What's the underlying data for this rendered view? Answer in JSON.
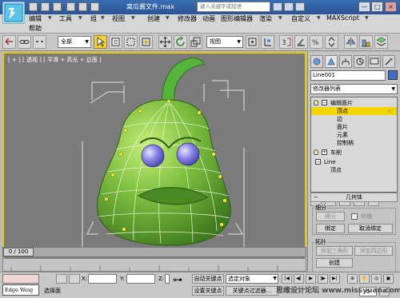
{
  "window": {
    "title": "窝瓜酱文件.max",
    "search_placeholder": "键入关键字或短语",
    "controls": [
      "—",
      "□",
      "×"
    ]
  },
  "menu": {
    "items": [
      "编辑",
      "工具",
      "组",
      "视图",
      "创建",
      "修改器",
      "动画",
      "图形编辑器",
      "渲染",
      "自定义",
      "MAXScript",
      "帮助"
    ]
  },
  "toolbar": {
    "selection_filter": "全部",
    "reference_coord": "视图"
  },
  "viewport": {
    "label": "[ + ] [ 透视 ] [ 平滑 + 高光 + 边面 ]",
    "border_color": "#e8c800",
    "background_color": "#7b7b7b"
  },
  "command_panel": {
    "object_name": "Line001",
    "object_color": "#3b6ec9",
    "modifier_list": "修改器列表",
    "stack": [
      {
        "label": "编辑面片",
        "level": 0,
        "expanded": true,
        "selected": false
      },
      {
        "label": "顶点",
        "level": 1,
        "selected": true
      },
      {
        "label": "边",
        "level": 1,
        "selected": false
      },
      {
        "label": "面片",
        "level": 1,
        "selected": false
      },
      {
        "label": "元素",
        "level": 1,
        "selected": false
      },
      {
        "label": "控制柄",
        "level": 1,
        "selected": false
      },
      {
        "label": "车削",
        "level": 0,
        "expanded": false,
        "selected": false
      },
      {
        "label": "Line",
        "level": 0,
        "expanded": true,
        "selected": false
      },
      {
        "label": "顶点",
        "level": 1,
        "selected": false
      }
    ],
    "rollout_title": "几何体",
    "subdivision": {
      "group_label": "细分",
      "subdivide_button": "细分",
      "propagate_label": "传播",
      "bind_button": "绑定",
      "unbind_button": "取消绑定"
    },
    "topology": {
      "group_label": "拓扑",
      "add_tri_button": "添加三角形",
      "add_quad_button": "添加四边形",
      "create_button": "创建"
    }
  },
  "timeline": {
    "time_slider": "0 / 100"
  },
  "status": {
    "maxscript_text": "Edge Weig",
    "prompt": "选择面",
    "x_label": "X:",
    "y_label": "Y:",
    "z_label": "Z:",
    "auto_key": "自动关键点",
    "set_key": "设置关键点",
    "selected_object": "选定对象",
    "key_filters": "关键点过滤器...",
    "current_frame": "0"
  },
  "watermark": "思缘设计论坛 www.missyuan.com"
}
